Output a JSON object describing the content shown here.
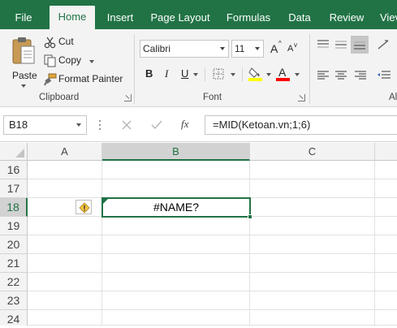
{
  "tabs": [
    {
      "label": "File"
    },
    {
      "label": "Home"
    },
    {
      "label": "Insert"
    },
    {
      "label": "Page Layout"
    },
    {
      "label": "Formulas"
    },
    {
      "label": "Data"
    },
    {
      "label": "Review"
    },
    {
      "label": "Viev"
    }
  ],
  "active_tab": "Home",
  "clipboard": {
    "paste_label": "Paste",
    "cut_label": "Cut",
    "copy_label": "Copy",
    "format_painter_label": "Format Painter",
    "group_label": "Clipboard"
  },
  "font": {
    "family": "Calibri",
    "size": "11",
    "grow_label": "A",
    "shrink_label": "A",
    "bold_label": "B",
    "italic_label": "I",
    "underline_label": "U",
    "font_color_label": "A",
    "group_label": "Font",
    "highlight_color": "#ffff00",
    "font_color": "#ff0000"
  },
  "alignment": {
    "group_label_partial": "Al"
  },
  "formula_bar": {
    "name_box": "B18",
    "cancel_icon": "close-icon",
    "enter_icon": "check-icon",
    "fx_label": "fx",
    "formula": "=MID(Ketoan.vn;1;6)"
  },
  "sheet": {
    "columns": [
      "A",
      "B",
      "C"
    ],
    "selected_column": "B",
    "rows": [
      "16",
      "17",
      "18",
      "19",
      "20",
      "21",
      "22",
      "23",
      "24"
    ],
    "selected_row": "18",
    "active_cell_value": "#NAME?",
    "accent": "#217346"
  }
}
